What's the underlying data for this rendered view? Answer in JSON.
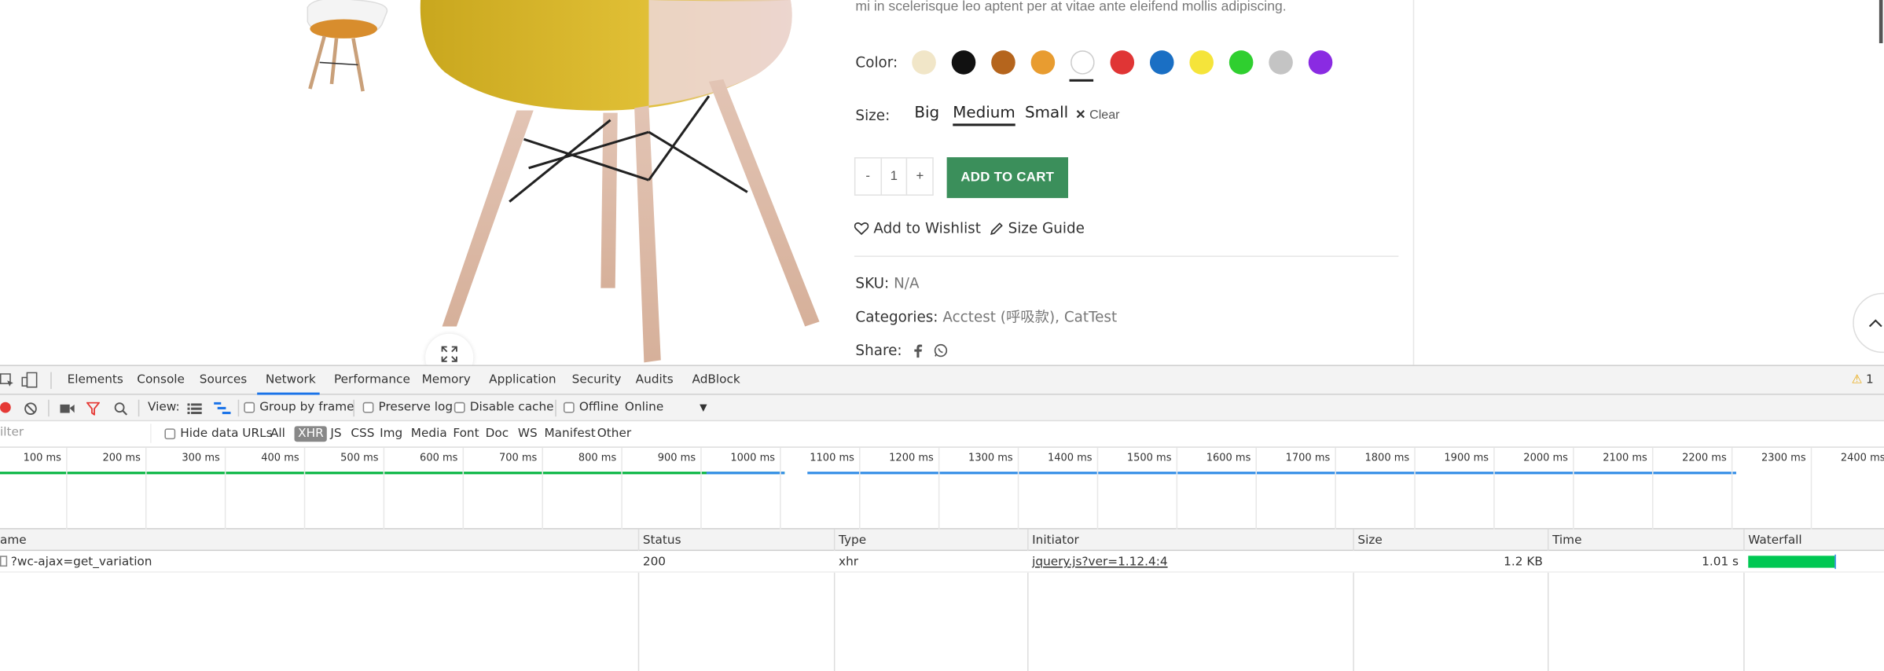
{
  "product": {
    "description_tail": "mi in scelerisque leo aptent per at vitae ante eleifend mollis adipiscing.",
    "color_label": "Color:",
    "swatches": [
      {
        "name": "cream",
        "color": "#f1e6c8"
      },
      {
        "name": "black",
        "color": "#111111"
      },
      {
        "name": "brown",
        "color": "#b5651d"
      },
      {
        "name": "orange",
        "color": "#e89c30"
      },
      {
        "name": "white",
        "color": "#ffffff"
      },
      {
        "name": "red",
        "color": "#e03535"
      },
      {
        "name": "blue",
        "color": "#1a6fc4"
      },
      {
        "name": "yellow",
        "color": "#f5e43a"
      },
      {
        "name": "green",
        "color": "#2fcf2f"
      },
      {
        "name": "gray",
        "color": "#c4c4c4"
      },
      {
        "name": "purple",
        "color": "#8a2be2"
      }
    ],
    "selected_color": "white",
    "size_label": "Size:",
    "sizes": [
      "Big",
      "Medium",
      "Small"
    ],
    "selected_size": "Medium",
    "clear_label": "Clear",
    "quantity": {
      "minus": "-",
      "value": "1",
      "plus": "+"
    },
    "add_to_cart": "ADD TO CART",
    "wishlist": "Add to Wishlist",
    "size_guide": "Size Guide",
    "sku_label": "SKU:",
    "sku_value": "N/A",
    "categories_label": "Categories:",
    "categories_value": "Acctest (呼吸款), CatTest",
    "share_label": "Share:",
    "accent_color": "#3b8f5b"
  },
  "devtools": {
    "tabs": [
      "Elements",
      "Console",
      "Sources",
      "Network",
      "Performance",
      "Memory",
      "Application",
      "Security",
      "Audits",
      "AdBlock"
    ],
    "active_tab": "Network",
    "warning_count": "1",
    "toolbar": {
      "view_label": "View:",
      "group_by_frame": "Group by frame",
      "preserve_log": "Preserve log",
      "disable_cache": "Disable cache",
      "offline": "Offline",
      "throttle": "Online"
    },
    "filter": {
      "placeholder": "ilter",
      "hide_data_urls": "Hide data URLs",
      "types": [
        "All",
        "XHR",
        "JS",
        "CSS",
        "Img",
        "Media",
        "Font",
        "Doc",
        "WS",
        "Manifest",
        "Other"
      ],
      "active_type": "XHR"
    },
    "timeline_ticks": [
      "100 ms",
      "200 ms",
      "300 ms",
      "400 ms",
      "500 ms",
      "600 ms",
      "700 ms",
      "800 ms",
      "900 ms",
      "1000 ms",
      "1100 ms",
      "1200 ms",
      "1300 ms",
      "1400 ms",
      "1500 ms",
      "1600 ms",
      "1700 ms",
      "1800 ms",
      "1900 ms",
      "2000 ms",
      "2100 ms",
      "2200 ms",
      "2300 ms",
      "2400 ms"
    ],
    "columns": [
      "ame",
      "Status",
      "Type",
      "Initiator",
      "Size",
      "Time",
      "Waterfall"
    ],
    "rows": [
      {
        "name": "?wc-ajax=get_variation",
        "status": "200",
        "type": "xhr",
        "initiator": "jquery.js?ver=1.12.4:4",
        "size": "1.2 KB",
        "time": "1.01 s"
      }
    ]
  }
}
